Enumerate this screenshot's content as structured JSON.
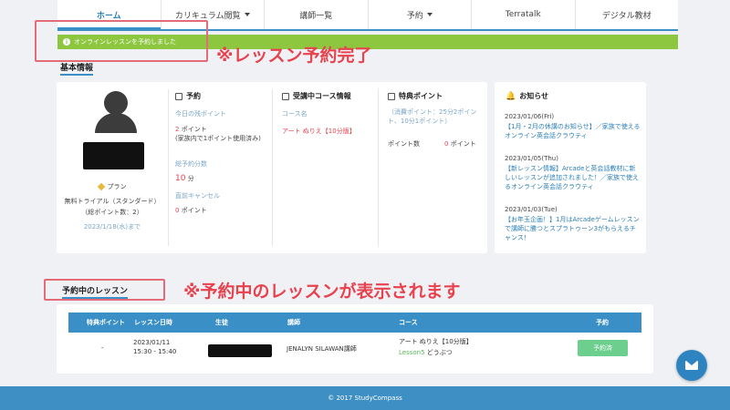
{
  "nav": {
    "items": [
      {
        "label": "ホーム",
        "active": true,
        "dropdown": false
      },
      {
        "label": "カリキュラム閲覧",
        "active": false,
        "dropdown": true
      },
      {
        "label": "講師一覧",
        "active": false,
        "dropdown": false
      },
      {
        "label": "予約",
        "active": false,
        "dropdown": true
      },
      {
        "label": "Terratalk",
        "active": false,
        "dropdown": false
      },
      {
        "label": "デジタル教材",
        "active": false,
        "dropdown": false
      }
    ]
  },
  "alert": {
    "message": "オンラインレッスンを予約しました",
    "icon": "info-icon",
    "color": "#8dc63f"
  },
  "annotations": {
    "reservation_done": "※レッスン予約完了",
    "lessons_shown": "※予約中のレッスンが表示されます"
  },
  "basic_info": {
    "title": "基本情報",
    "profile": {
      "plan_label": "プラン",
      "plan_name": "無料トライアル（スタンダード）",
      "total_points": "（総ポイント数：2）",
      "expires": "2023/1/18(水)まで"
    },
    "reservation": {
      "heading": "予約",
      "today_points_label": "今日の残ポイント",
      "today_points_value": "2",
      "today_points_unit": "ポイント",
      "family_note": "(家族内で1ポイント使用済み)",
      "total_minutes_label": "総予約分数",
      "total_minutes_value": "10",
      "total_minutes_unit": "分",
      "cancel_label": "直前キャンセル",
      "cancel_value": "0",
      "cancel_unit": "ポイント"
    },
    "course": {
      "heading": "受講中コース情報",
      "course_name_label": "コース名",
      "course_name_value": "アート ぬりえ【10分版】"
    },
    "bonus": {
      "heading": "特典ポイント",
      "consumption_note": "（消費ポイント：25分2ポイント、10分1ポイント）",
      "points_label": "ポイント数",
      "points_value": "0",
      "points_unit": "ポイント"
    },
    "news": {
      "heading": "お知らせ",
      "items": [
        {
          "date": "2023/01/06(Fri)",
          "text": "【1月・2月の休講のお知らせ】／家族で使えるオンライン英会話クラウティ"
        },
        {
          "date": "2023/01/05(Thu)",
          "text": "【新レッスン情報】Arcadeと英会話教材に新しいレッスンが追加されました！／家族で使えるオンライン英会話クラウティ"
        },
        {
          "date": "2023/01/03(Tue)",
          "text": "【お年玉企画！】1月はArcadeゲームレッスンで講師に勝つとスプラトゥーン3がもらえるチャンス！"
        }
      ]
    }
  },
  "lessons": {
    "title": "予約中のレッスン",
    "headers": [
      "特典ポイント",
      "レッスン日時",
      "生徒",
      "講師",
      "コース",
      "予約"
    ],
    "rows": [
      {
        "bonus": "-",
        "date": "2023/01/11",
        "time": "15:30 - 15:40",
        "student": "",
        "teacher": "JENALYN SILAWAN講師",
        "course": "アート ぬりえ【10分版】",
        "lesson": "Lesson5",
        "lesson_topic": "どうぶつ",
        "status": "予約済"
      }
    ]
  },
  "footer": {
    "copyright": "© 2017 StudyCompass"
  },
  "colors": {
    "accent": "#3a8fc6",
    "success": "#8dc63f",
    "annotation": "#e8424f"
  }
}
